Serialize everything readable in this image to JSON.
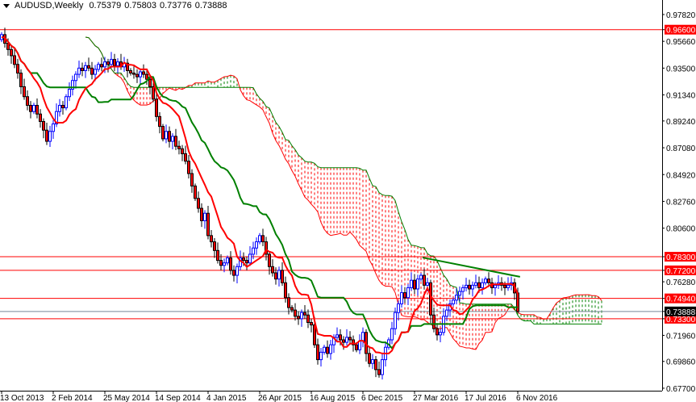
{
  "header": {
    "symbol_timeframe": "AUDUSD,Weekly",
    "open": "0.75379",
    "high": "0.75803",
    "low": "0.73776",
    "close": "0.73888"
  },
  "chart_data": {
    "type": "candlestick",
    "title": "AUDUSD,Weekly",
    "ylim": [
      0.675,
      0.9899
    ],
    "grid": false,
    "closes": [
      0.962,
      0.955,
      0.95,
      0.945,
      0.938,
      0.931,
      0.92,
      0.912,
      0.905,
      0.9,
      0.905,
      0.898,
      0.892,
      0.885,
      0.876,
      0.884,
      0.89,
      0.9,
      0.905,
      0.903,
      0.912,
      0.918,
      0.925,
      0.93,
      0.935,
      0.933,
      0.937,
      0.935,
      0.93,
      0.934,
      0.938,
      0.936,
      0.94,
      0.938,
      0.942,
      0.937,
      0.94,
      0.936,
      0.939,
      0.933,
      0.931,
      0.93,
      0.928,
      0.932,
      0.93,
      0.926,
      0.92,
      0.91,
      0.896,
      0.888,
      0.878,
      0.884,
      0.876,
      0.88,
      0.872,
      0.87,
      0.866,
      0.86,
      0.85,
      0.84,
      0.83,
      0.822,
      0.812,
      0.818,
      0.8,
      0.795,
      0.788,
      0.78,
      0.776,
      0.778,
      0.782,
      0.772,
      0.768,
      0.775,
      0.782,
      0.78,
      0.778,
      0.785,
      0.79,
      0.795,
      0.8,
      0.795,
      0.785,
      0.775,
      0.77,
      0.765,
      0.772,
      0.762,
      0.75,
      0.742,
      0.74,
      0.735,
      0.733,
      0.738,
      0.736,
      0.73,
      0.728,
      0.712,
      0.7,
      0.706,
      0.71,
      0.705,
      0.712,
      0.718,
      0.72,
      0.716,
      0.714,
      0.718,
      0.716,
      0.712,
      0.708,
      0.715,
      0.722,
      0.705,
      0.697,
      0.7,
      0.692,
      0.688,
      0.7,
      0.71,
      0.716,
      0.725,
      0.738,
      0.745,
      0.754,
      0.75,
      0.758,
      0.764,
      0.757,
      0.765,
      0.768,
      0.76,
      0.762,
      0.736,
      0.725,
      0.72,
      0.722,
      0.735,
      0.74,
      0.745,
      0.748,
      0.752,
      0.755,
      0.758,
      0.76,
      0.757,
      0.76,
      0.762,
      0.758,
      0.762,
      0.765,
      0.762,
      0.758,
      0.76,
      0.762,
      0.76,
      0.758,
      0.76,
      0.762,
      0.75379
    ],
    "last_bar": {
      "open": 0.75379,
      "high": 0.75803,
      "low": 0.73776,
      "close": 0.73888
    },
    "ichimoku": {
      "tenkan": 9,
      "kijun": 26,
      "senkou_b": 52,
      "shift": 26
    },
    "y_ticks": [
      "0.97820",
      "0.95660",
      "0.93500",
      "0.91340",
      "0.89240",
      "0.87080",
      "0.84920",
      "0.82760",
      "0.80600",
      "0.76280",
      "0.71960",
      "0.69860",
      "0.67700"
    ],
    "hlines": [
      "0.96600",
      "0.78300",
      "0.77200",
      "0.74940",
      "0.73300"
    ],
    "bid": "0.73888",
    "x_ticks": [
      {
        "label": "13 Oct 2013",
        "bar": 0
      },
      {
        "label": "2 Feb 2014",
        "bar": 16
      },
      {
        "label": "25 May 2014",
        "bar": 32
      },
      {
        "label": "14 Sep 2014",
        "bar": 48
      },
      {
        "label": "4 Jan 2015",
        "bar": 64
      },
      {
        "label": "26 Apr 2015",
        "bar": 80
      },
      {
        "label": "16 Aug 2015",
        "bar": 96
      },
      {
        "label": "6 Dec 2015",
        "bar": 112
      },
      {
        "label": "27 Mar 2016",
        "bar": 128
      },
      {
        "label": "17 Jul 2016",
        "bar": 144
      },
      {
        "label": "6 Nov 2016",
        "bar": 160
      }
    ],
    "trendline": {
      "from": {
        "bar": 130.5,
        "price": 0.7823
      },
      "to": {
        "bar": 160.7,
        "price": 0.7668
      }
    },
    "colors": {
      "bull": "#0000ff",
      "bear_fill": "#ff0000",
      "tenkan": "#ff0000",
      "kijun": "#008000",
      "span_a": "#ff0000",
      "span_b": "#008000",
      "hline": "#ff0000",
      "bid_line": "#778899",
      "trendline": "#008000"
    }
  }
}
